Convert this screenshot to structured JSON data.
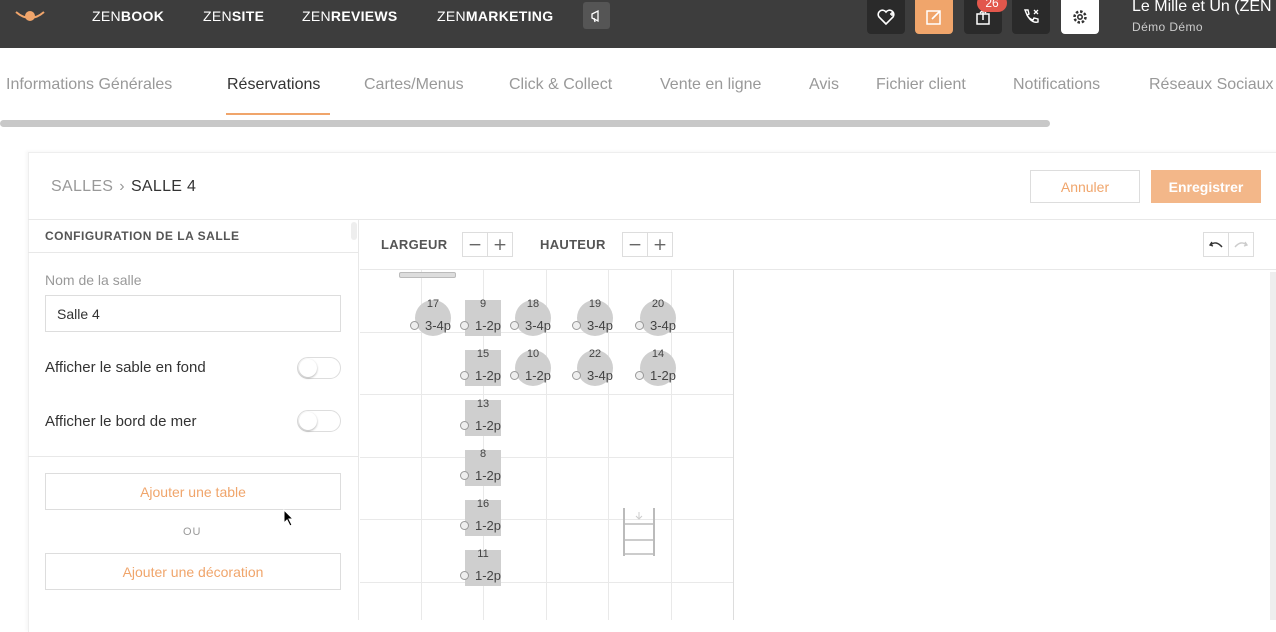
{
  "topbar": {
    "nav": [
      {
        "prefix": "ZEN",
        "suffix": "BOOK"
      },
      {
        "prefix": "ZEN",
        "suffix": "SITE"
      },
      {
        "prefix": "ZEN",
        "suffix": "REVIEWS"
      },
      {
        "prefix": "ZEN",
        "suffix": "MARKETING"
      }
    ],
    "badge_count": "26",
    "account_name": "Le Mille et Un (ZEN",
    "account_sub": "Démo Démo"
  },
  "tabs": [
    {
      "label": "Informations Générales",
      "active": false
    },
    {
      "label": "Réservations",
      "active": true
    },
    {
      "label": "Cartes/Menus",
      "active": false
    },
    {
      "label": "Click & Collect",
      "active": false
    },
    {
      "label": "Vente en ligne",
      "active": false
    },
    {
      "label": "Avis",
      "active": false
    },
    {
      "label": "Fichier client",
      "active": false
    },
    {
      "label": "Notifications",
      "active": false
    },
    {
      "label": "Réseaux Sociaux",
      "active": false
    }
  ],
  "breadcrumb": {
    "parent": "SALLES",
    "separator": "›",
    "current": "SALLE 4"
  },
  "actions": {
    "cancel": "Annuler",
    "save": "Enregistrer"
  },
  "sidebar": {
    "title": "CONFIGURATION DE LA SALLE",
    "name_label": "Nom de la salle",
    "name_value": "Salle 4",
    "toggles": [
      {
        "label": "Afficher le sable en fond",
        "on": false
      },
      {
        "label": "Afficher le bord de mer",
        "on": false
      }
    ],
    "add_table": "Ajouter une table",
    "or": "OU",
    "add_decoration": "Ajouter une décoration"
  },
  "canvas": {
    "width_label": "LARGEUR",
    "height_label": "HAUTEUR",
    "minus": "−",
    "plus": "+"
  },
  "tables": [
    {
      "number": "17",
      "capacity": "3-4p",
      "shape": "round"
    },
    {
      "number": "9",
      "capacity": "1-2p",
      "shape": "square"
    },
    {
      "number": "18",
      "capacity": "3-4p",
      "shape": "round"
    },
    {
      "number": "19",
      "capacity": "3-4p",
      "shape": "round"
    },
    {
      "number": "20",
      "capacity": "3-4p",
      "shape": "round"
    },
    {
      "number": "15",
      "capacity": "1-2p",
      "shape": "square"
    },
    {
      "number": "10",
      "capacity": "1-2p",
      "shape": "round"
    },
    {
      "number": "22",
      "capacity": "3-4p",
      "shape": "round"
    },
    {
      "number": "14",
      "capacity": "1-2p",
      "shape": "round"
    },
    {
      "number": "13",
      "capacity": "1-2p",
      "shape": "square"
    },
    {
      "number": "8",
      "capacity": "1-2p",
      "shape": "square"
    },
    {
      "number": "16",
      "capacity": "1-2p",
      "shape": "square"
    },
    {
      "number": "11",
      "capacity": "1-2p",
      "shape": "square"
    }
  ],
  "colors": {
    "accent": "#f0a56b",
    "topbar": "#3d3d3d",
    "badge": "#e2574c"
  }
}
